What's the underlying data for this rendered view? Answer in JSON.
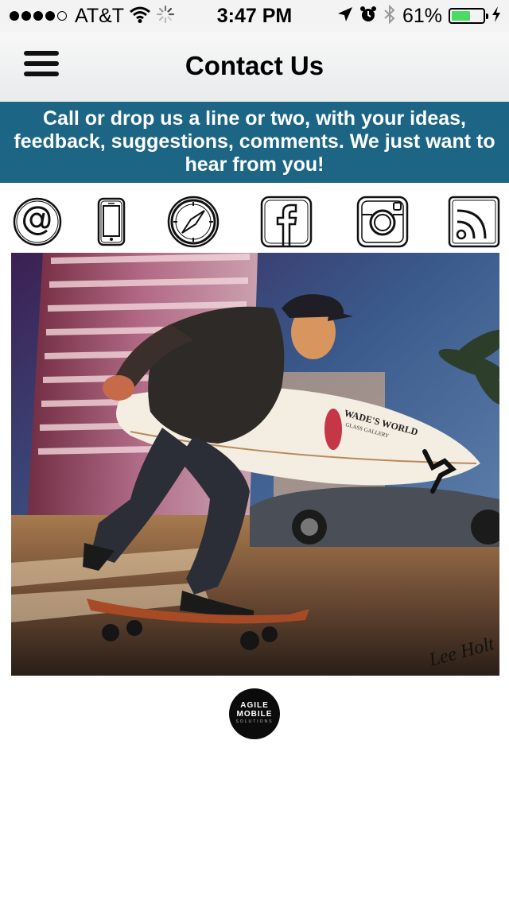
{
  "status_bar": {
    "carrier": "AT&T",
    "time": "3:47 PM",
    "battery_percent": "61%",
    "battery_level": 0.61,
    "signal_bars_filled": 4,
    "signal_bars_total": 5,
    "icons": [
      "signal-dots-icon",
      "wifi-icon",
      "activity-spinner-icon",
      "location-arrow-icon",
      "alarm-clock-icon",
      "bluetooth-icon",
      "battery-icon",
      "charging-bolt-icon"
    ]
  },
  "nav": {
    "title": "Contact Us",
    "menu_icon": "hamburger-menu-icon"
  },
  "banner": {
    "text": "Call or drop us a line or two, with your ideas, feedback, suggestions, comments. We just want to hear from you!",
    "background": "#1d6585"
  },
  "contact_icons": [
    "email-at-icon",
    "phone-icon",
    "compass-safari-icon",
    "facebook-icon",
    "instagram-icon",
    "rss-feed-icon"
  ],
  "photo": {
    "signature_text": "Lee Holt",
    "surfboard_text": "WADE'S WORLD",
    "surfboard_subtext": "GLASS GALLERY"
  },
  "logo": {
    "line1": "AGILE",
    "line2": "MOBILE",
    "line3": "SOLUTIONS"
  },
  "colors": {
    "banner_bg": "#1d6585",
    "battery_green": "#4cd964"
  }
}
